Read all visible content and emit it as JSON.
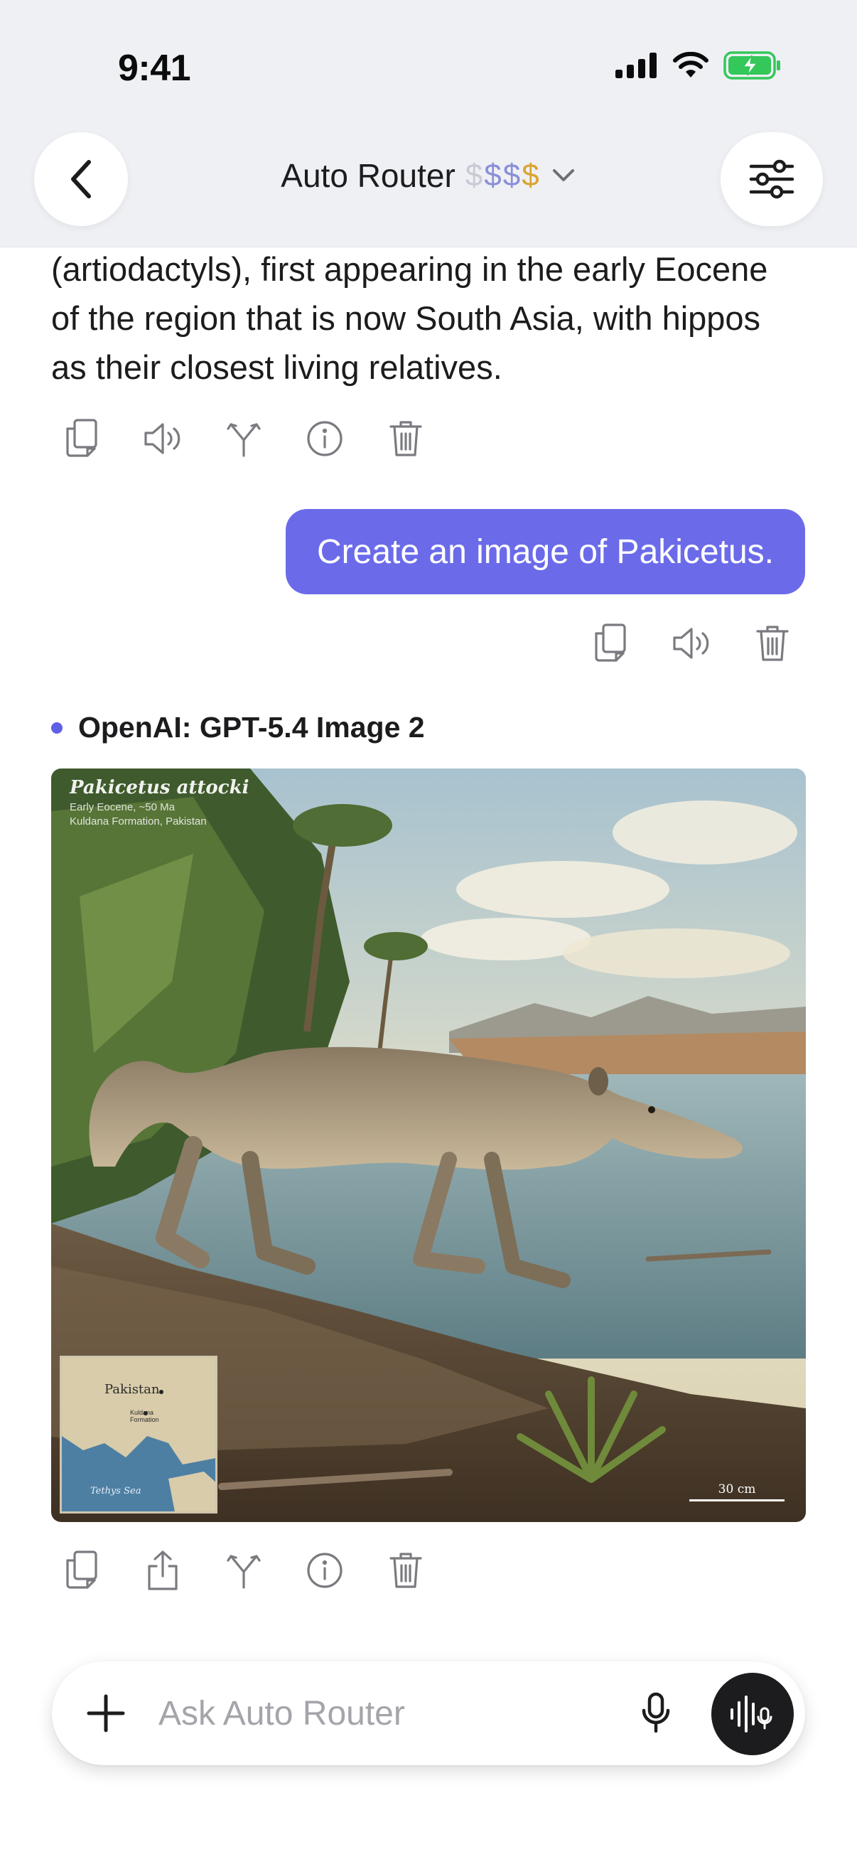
{
  "status_bar": {
    "time": "9:41",
    "icons": [
      "cellular-signal-icon",
      "wifi-icon",
      "battery-charging-icon"
    ],
    "battery_color": "#34c759"
  },
  "header": {
    "back_icon": "chevron-left-icon",
    "title": "Auto Router",
    "price_tier": [
      "$",
      "$",
      "$",
      "$"
    ],
    "price_colors": [
      "#c8c9d4",
      "#8a8fd8",
      "#8a8fd8",
      "#d9a431"
    ],
    "dropdown_icon": "chevron-down-icon",
    "settings_icon": "sliders-icon"
  },
  "conversation": {
    "assistant_text_fragment": "(artiodactyls), first appearing in the early Eocene of the region that is now South Asia, with hippos as their closest living relatives.",
    "assistant_actions": [
      "copy-icon",
      "speaker-icon",
      "branch-icon",
      "info-icon",
      "trash-icon"
    ],
    "user_message": "Create an image of Pakicetus.",
    "user_bubble_color": "#6b6bea",
    "user_actions": [
      "copy-icon",
      "speaker-icon",
      "trash-icon"
    ],
    "model_name": "OpenAI: GPT-5.4 Image 2",
    "model_dot_color": "#5e60e6",
    "image": {
      "title": "Pakicetus attocki",
      "subtitle_1": "Early Eocene, ~50 Ma",
      "subtitle_2": "Kuldana Formation, Pakistan",
      "map_country": "Pakistan",
      "map_site": "Kuldana Formation",
      "map_sea": "Tethys Sea",
      "scale": "30 cm"
    },
    "image_actions": [
      "copy-icon",
      "share-icon",
      "branch-icon",
      "info-icon",
      "trash-icon"
    ]
  },
  "composer": {
    "placeholder": "Ask Auto Router",
    "plus_icon": "plus-icon",
    "mic_icon": "microphone-icon",
    "voice_icon": "voice-mode-icon"
  }
}
